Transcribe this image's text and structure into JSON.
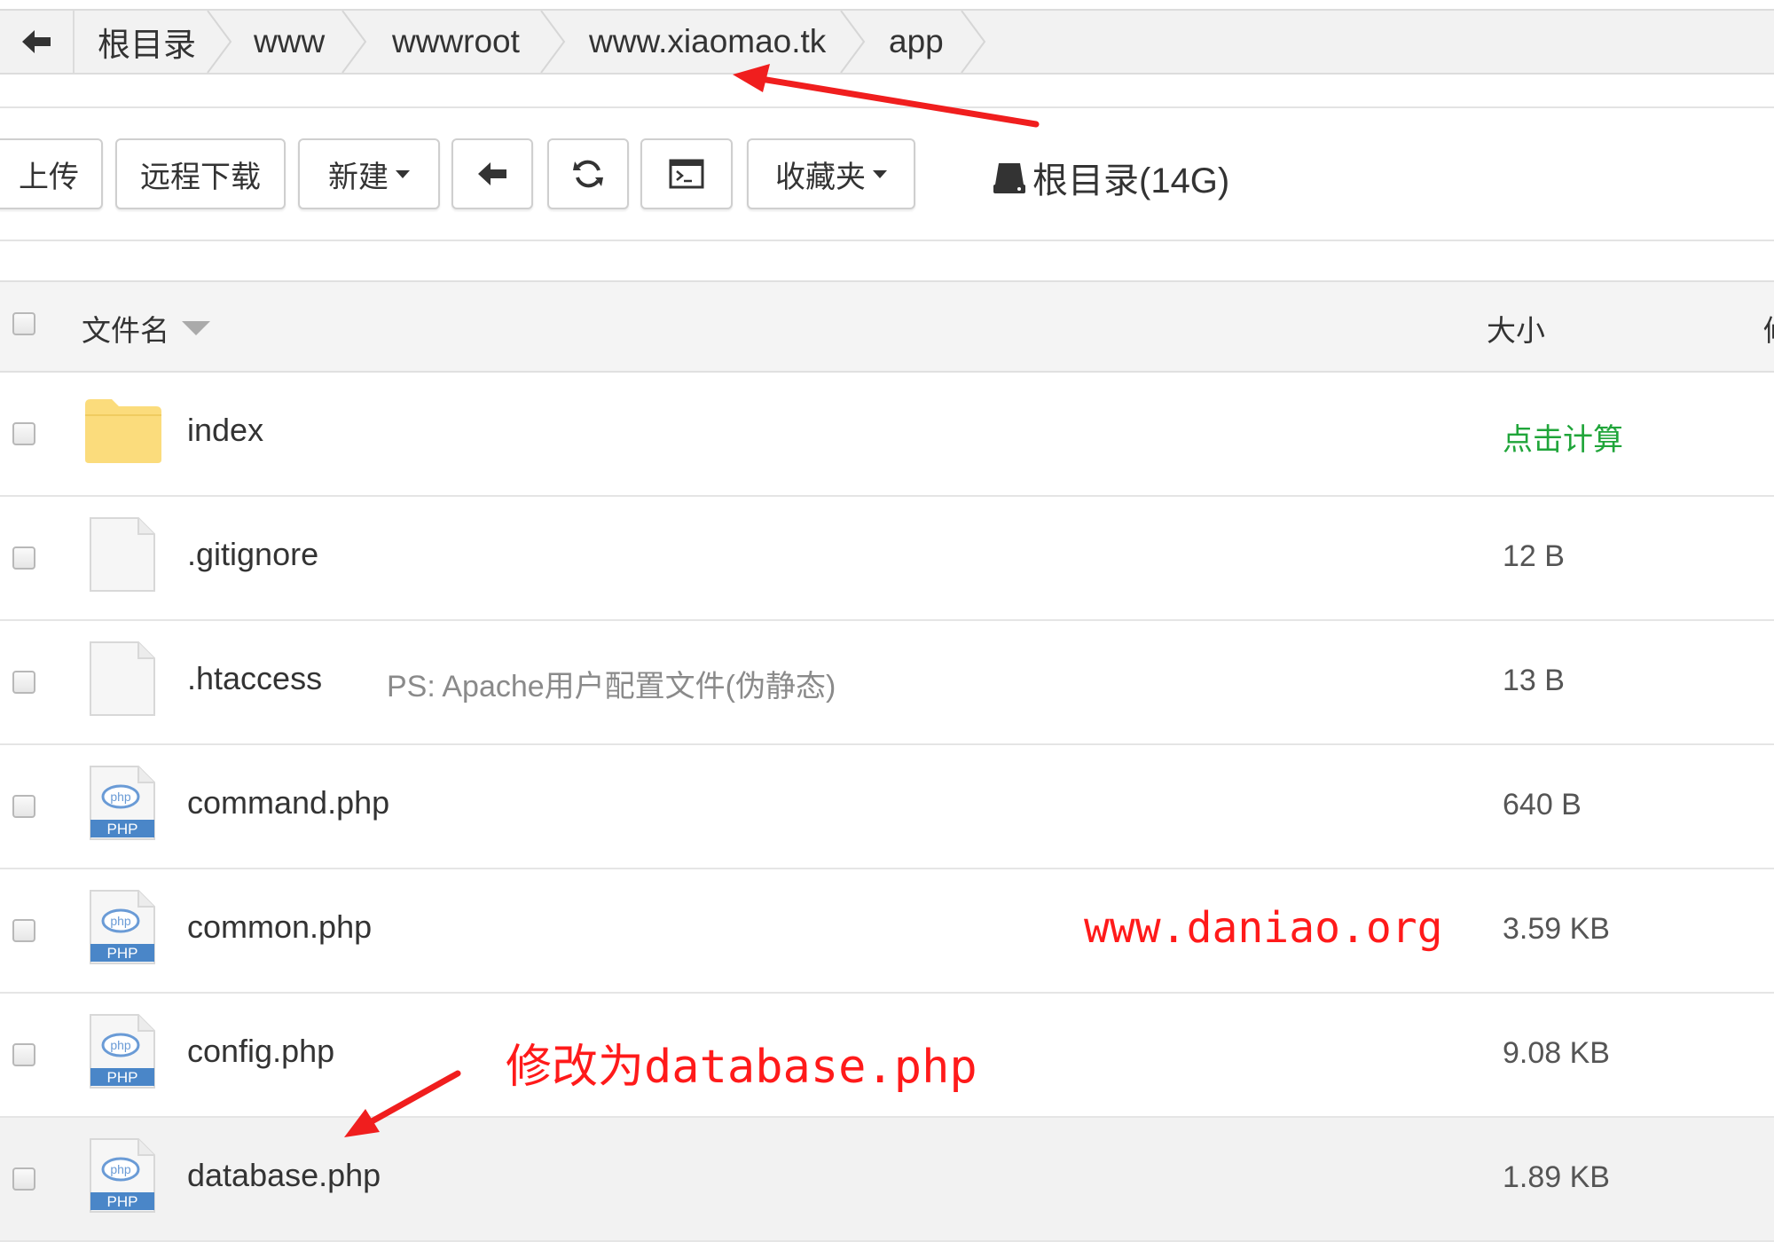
{
  "breadcrumb": {
    "items": [
      {
        "label": "根目录"
      },
      {
        "label": "www"
      },
      {
        "label": "wwwroot"
      },
      {
        "label": "www.xiaomao.tk"
      },
      {
        "label": "app"
      }
    ]
  },
  "toolbar": {
    "upload_label": "上传",
    "remote_download_label": "远程下载",
    "new_label": "新建",
    "favorites_label": "收藏夹",
    "disk_label": "根目录(14G)"
  },
  "table": {
    "col_name": "文件名",
    "col_size": "大小",
    "col_edge": "修",
    "rows": [
      {
        "name": "index",
        "type": "folder",
        "size": "点击计算",
        "note": ""
      },
      {
        "name": ".gitignore",
        "type": "file",
        "size": "12 B",
        "note": ""
      },
      {
        "name": ".htaccess",
        "type": "file",
        "size": "13 B",
        "note": "PS: Apache用户配置文件(伪静态)"
      },
      {
        "name": "command.php",
        "type": "php",
        "size": "640 B",
        "note": ""
      },
      {
        "name": "common.php",
        "type": "php",
        "size": "3.59 KB",
        "note": ""
      },
      {
        "name": "config.php",
        "type": "php",
        "size": "9.08 KB",
        "note": ""
      },
      {
        "name": "database.php",
        "type": "php",
        "size": "1.89 KB",
        "note": ""
      }
    ]
  },
  "annotations": {
    "watermark": "www.daniao.org",
    "rename_note": "修改为database.php"
  },
  "colors": {
    "annotation_red": "#ff1a1a",
    "calc_green": "#20a53a",
    "folder_yellow": "#fbdc7c",
    "php_blue": "#4a86c8"
  },
  "icons": {
    "php_badge": "PHP",
    "php_logo": "php"
  }
}
